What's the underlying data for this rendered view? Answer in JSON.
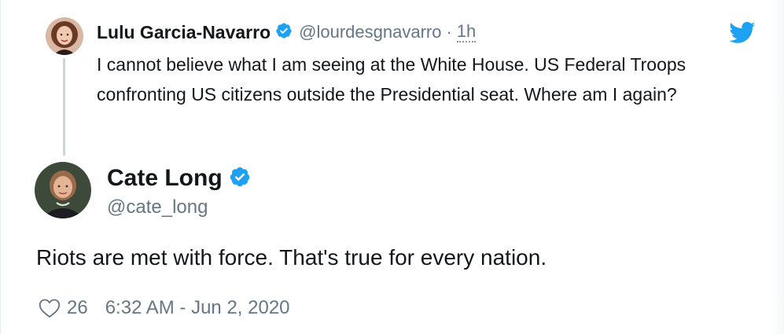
{
  "parent_tweet": {
    "name": "Lulu Garcia-Navarro",
    "handle": "@lourdesgnavarro",
    "separator": "·",
    "time": "1h",
    "text": "I cannot believe what I am seeing at the White House. US Federal Troops confronting US citizens outside the Presidential seat. Where am I again?",
    "avatar_icon": "profile-photo"
  },
  "main_tweet": {
    "name": "Cate Long",
    "handle": "@cate_long",
    "text": "Riots are met with force. That's true for every nation.",
    "likes": "26",
    "timestamp": "6:32 AM - Jun 2, 2020",
    "avatar_icon": "profile-photo"
  },
  "icons": {
    "verified": "verified-badge-icon",
    "brand": "twitter-bird-icon",
    "like": "heart-icon"
  },
  "colors": {
    "brand_blue": "#1da1f2",
    "text_primary": "#14171a",
    "text_secondary": "#657786",
    "thread_line": "#ccd6dd"
  }
}
